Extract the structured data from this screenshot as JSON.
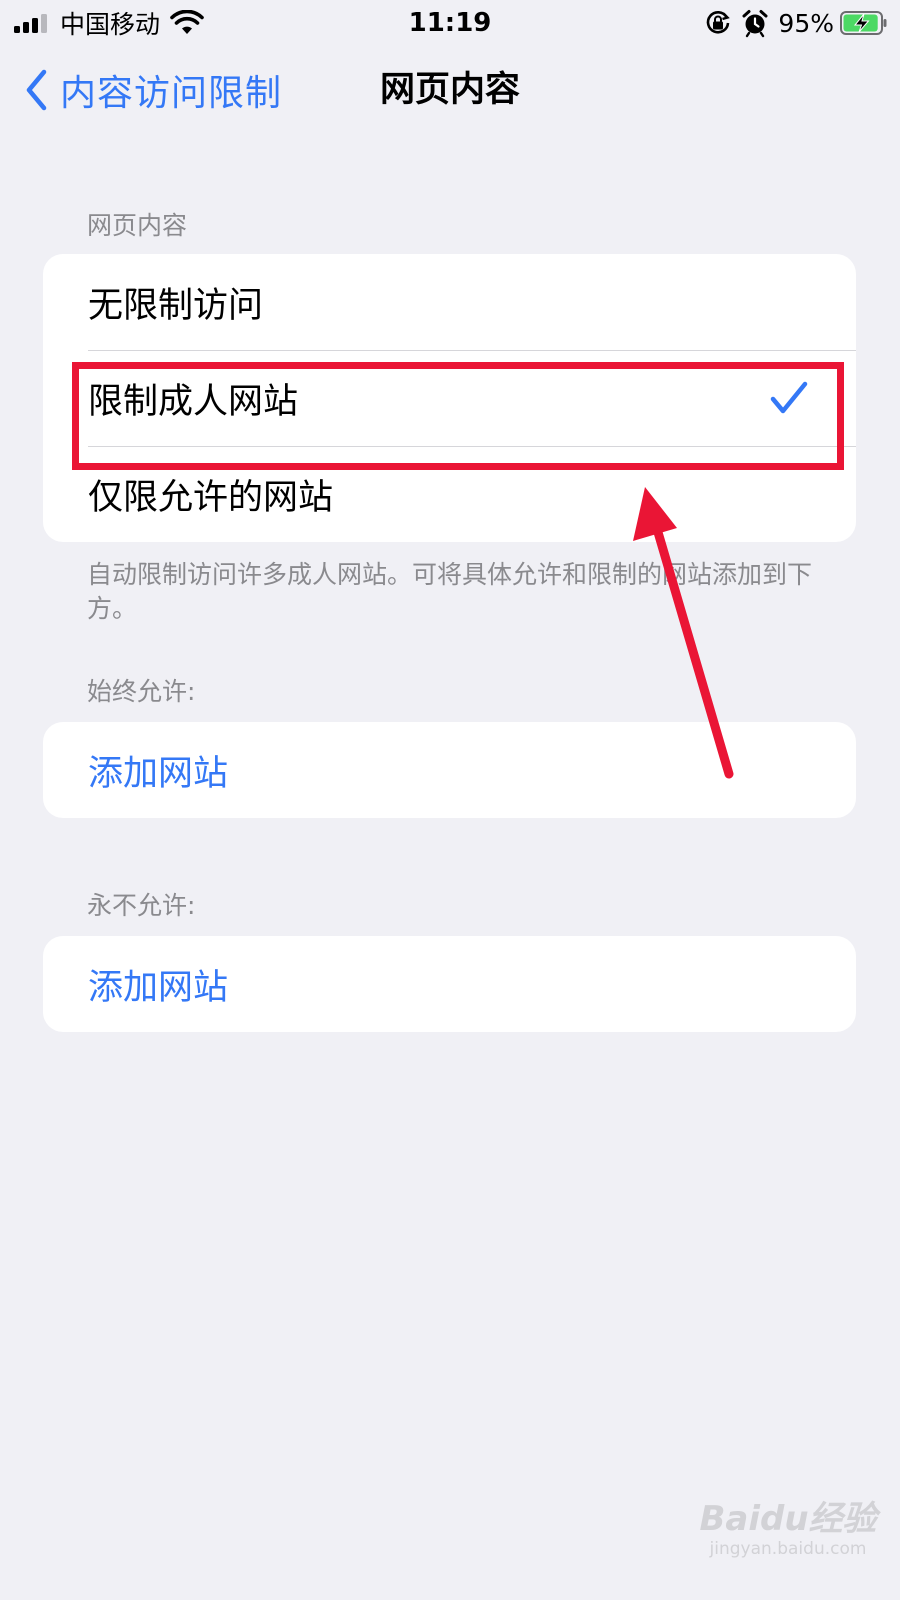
{
  "status_bar": {
    "carrier": "中国移动",
    "time": "11:19",
    "battery_percent": "95%",
    "battery_level": 0.95,
    "icons": [
      "signal-icon",
      "wifi-icon",
      "orientation-lock-icon",
      "alarm-icon",
      "battery-charging-icon"
    ]
  },
  "nav": {
    "back_label": "内容访问限制",
    "title": "网页内容"
  },
  "web_content": {
    "header": "网页内容",
    "options": [
      {
        "label": "无限制访问",
        "selected": false
      },
      {
        "label": "限制成人网站",
        "selected": true
      },
      {
        "label": "仅限允许的网站",
        "selected": false
      }
    ],
    "footer": "自动限制访问许多成人网站。可将具体允许和限制的网站添加到下方。"
  },
  "always_allow": {
    "header": "始终允许:",
    "add_label": "添加网站"
  },
  "never_allow": {
    "header": "永不允许:",
    "add_label": "添加网站"
  },
  "annotation": {
    "color": "#ea1535"
  },
  "colors": {
    "accent": "#3478f6",
    "background": "#f0f0f5",
    "battery_green": "#4cd964"
  },
  "watermark": {
    "logo": "Baidu经验",
    "url": "jingyan.baidu.com"
  }
}
